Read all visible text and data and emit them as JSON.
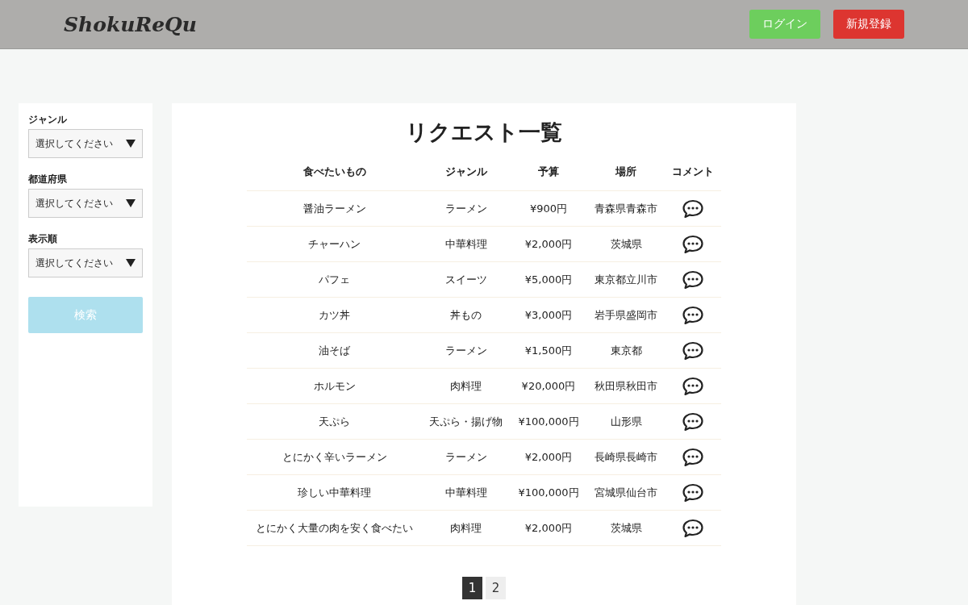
{
  "header": {
    "logo": "ShokuReQu",
    "buttons": [
      {
        "label": "ログイン",
        "kind": "login"
      },
      {
        "label": "新規登録",
        "kind": "signup"
      }
    ]
  },
  "filters": [
    {
      "label": "ジャンル",
      "placeholder": "選択してください"
    },
    {
      "label": "都道府県",
      "placeholder": "選択してください"
    },
    {
      "label": "表示順",
      "placeholder": "選択してください"
    }
  ],
  "search_button": {
    "label": "検索",
    "disabled": true
  },
  "title": "リクエスト一覧",
  "table": {
    "columns": [
      "食べたいもの",
      "ジャンル",
      "予算",
      "場所",
      "コメント"
    ],
    "rows": [
      {
        "cells": [
          "醤油ラーメン",
          "ラーメン",
          "¥900円",
          "青森県青森市"
        ]
      },
      {
        "cells": [
          "チャーハン",
          "中華料理",
          "¥2,000円",
          "茨城県"
        ]
      },
      {
        "cells": [
          "パフェ",
          "スイーツ",
          "¥5,000円",
          "東京都立川市"
        ]
      },
      {
        "cells": [
          "カツ丼",
          "丼もの",
          "¥3,000円",
          "岩手県盛岡市"
        ]
      },
      {
        "cells": [
          "油そば",
          "ラーメン",
          "¥1,500円",
          "東京都"
        ]
      },
      {
        "cells": [
          "ホルモン",
          "肉料理",
          "¥20,000円",
          "秋田県秋田市"
        ]
      },
      {
        "cells": [
          "天ぷら",
          "天ぷら・揚げ物",
          "¥100,000円",
          "山形県"
        ]
      },
      {
        "cells": [
          "とにかく辛いラーメン",
          "ラーメン",
          "¥2,000円",
          "長崎県長崎市"
        ]
      },
      {
        "cells": [
          "珍しい中華料理",
          "中華料理",
          "¥100,000円",
          "宮城県仙台市"
        ]
      },
      {
        "cells": [
          "とにかく大量の肉を安く食べたい",
          "肉料理",
          "¥2,000円",
          "茨城県"
        ]
      }
    ]
  },
  "pagination": [
    {
      "label": "1",
      "selected": true
    },
    {
      "label": "2",
      "selected": false
    }
  ]
}
